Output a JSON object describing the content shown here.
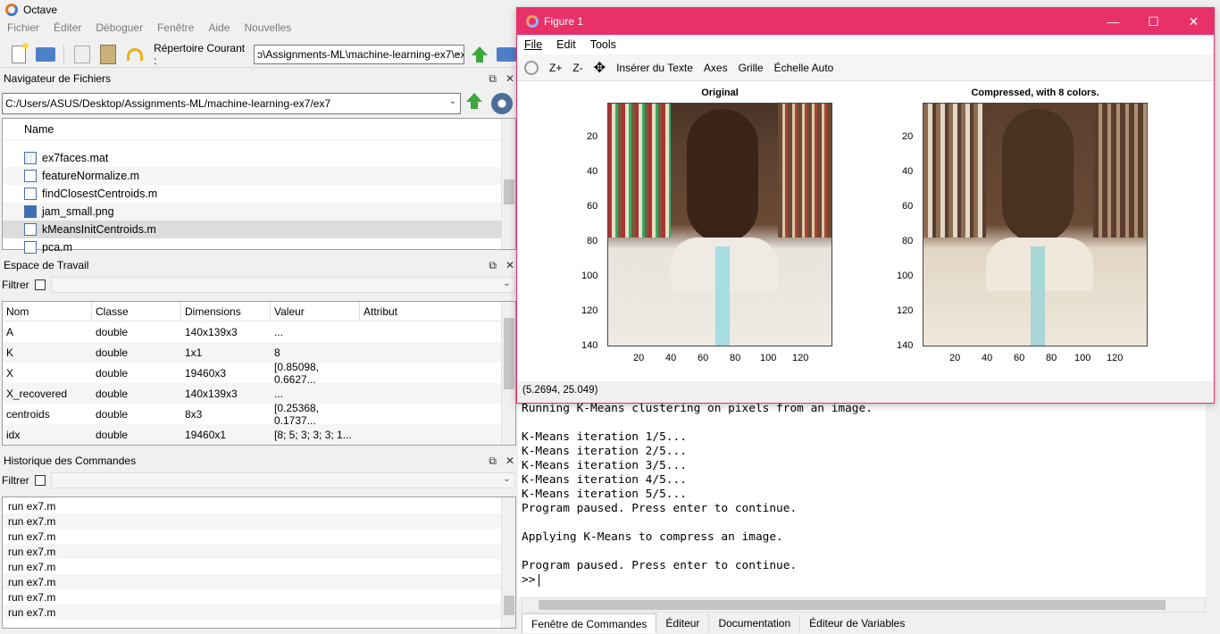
{
  "app": {
    "title": "Octave"
  },
  "menu": [
    "Fichier",
    "Éditer",
    "Déboguer",
    "Fenêtre",
    "Aide",
    "Nouvelles"
  ],
  "toolbar": {
    "current_dir_label": "Répertoire Courant :",
    "current_dir_value": "ɔ\\Assignments-ML\\machine-learning-ex7\\ex7"
  },
  "file_browser": {
    "title": "Navigateur de Fichiers",
    "path": "C:/Users/ASUS/Desktop/Assignments-ML/machine-learning-ex7/ex7",
    "column": "Name",
    "files": [
      {
        "name": "ex7faces.mat",
        "icon": "mat-file-icon"
      },
      {
        "name": "featureNormalize.m",
        "icon": "m-file-icon"
      },
      {
        "name": "findClosestCentroids.m",
        "icon": "m-file-icon"
      },
      {
        "name": "jam_small.png",
        "icon": "png-file-icon"
      },
      {
        "name": "kMeansInitCentroids.m",
        "icon": "m-file-icon"
      },
      {
        "name": "pca.m",
        "icon": "m-file-icon"
      }
    ]
  },
  "workspace": {
    "title": "Espace de Travail",
    "filter_label": "Filtrer",
    "columns": [
      "Nom",
      "Classe",
      "Dimensions",
      "Valeur",
      "Attribut"
    ],
    "rows": [
      [
        "A",
        "double",
        "140x139x3",
        "...",
        ""
      ],
      [
        "K",
        "double",
        "1x1",
        "8",
        ""
      ],
      [
        "X",
        "double",
        "19460x3",
        "[0.85098, 0.6627...",
        ""
      ],
      [
        "X_recovered",
        "double",
        "140x139x3",
        "...",
        ""
      ],
      [
        "centroids",
        "double",
        "8x3",
        "[0.25368, 0.1737...",
        ""
      ],
      [
        "idx",
        "double",
        "19460x1",
        "[8; 5; 3; 3; 3; 1...",
        ""
      ]
    ]
  },
  "history": {
    "title": "Historique des Commandes",
    "filter_label": "Filtrer",
    "items": [
      "run ex7.m",
      "run ex7.m",
      "run ex7.m",
      "run ex7.m",
      "run ex7.m",
      "run ex7.m",
      "run ex7.m",
      "run ex7.m"
    ]
  },
  "figure": {
    "title": "Figure 1",
    "menu": [
      "File",
      "Edit",
      "Tools"
    ],
    "tools": [
      "Z+",
      "Z-",
      "Insérer du Texte",
      "Axes",
      "Grille",
      "Échelle Auto"
    ],
    "status": "(5.2694, 25.049)",
    "plots": [
      {
        "title": "Original",
        "yticks": [
          "20",
          "40",
          "60",
          "80",
          "100",
          "120",
          "140"
        ],
        "xticks": [
          "20",
          "40",
          "60",
          "80",
          "100",
          "120"
        ]
      },
      {
        "title": "Compressed, with 8 colors.",
        "yticks": [
          "20",
          "40",
          "60",
          "80",
          "100",
          "120",
          "140"
        ],
        "xticks": [
          "20",
          "40",
          "60",
          "80",
          "100",
          "120"
        ]
      }
    ]
  },
  "console": {
    "lines": [
      "Running K-Means clustering on pixels from an image.",
      "",
      "K-Means iteration 1/5...",
      "K-Means iteration 2/5...",
      "K-Means iteration 3/5...",
      "K-Means iteration 4/5...",
      "K-Means iteration 5/5...",
      "Program paused. Press enter to continue.",
      "",
      "Applying K-Means to compress an image.",
      "",
      "Program paused. Press enter to continue."
    ],
    "prompt": ">>"
  },
  "tabs": [
    "Fenêtre de Commandes",
    "Éditeur",
    "Documentation",
    "Éditeur de Variables"
  ]
}
